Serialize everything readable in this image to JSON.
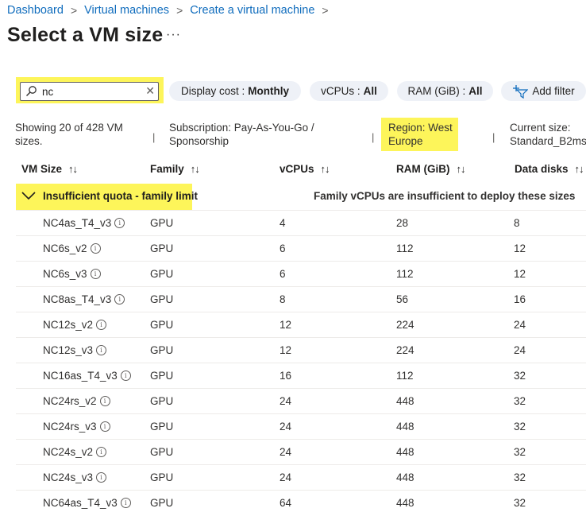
{
  "breadcrumb": [
    {
      "label": "Dashboard"
    },
    {
      "label": "Virtual machines"
    },
    {
      "label": "Create a virtual machine"
    }
  ],
  "page": {
    "title": "Select a VM size",
    "more": "···"
  },
  "search": {
    "value": "nc",
    "icon": "search-icon",
    "clear": "✕"
  },
  "filters": {
    "cost_label": "Display cost :",
    "cost_value": "Monthly",
    "vcpu_label": "vCPUs :",
    "vcpu_value": "All",
    "ram_label": "RAM (GiB) :",
    "ram_value": "All",
    "add_filter": "Add filter"
  },
  "info": {
    "count": "Showing 20 of 428 VM sizes.",
    "subscription": "Subscription: Pay-As-You-Go / Sponsorship",
    "region": "Region: West Europe",
    "current_size": "Current size: Standard_B2ms",
    "divider": "|"
  },
  "columns": [
    {
      "label": "VM Size",
      "sort": "↑↓"
    },
    {
      "label": "Family",
      "sort": "↑↓"
    },
    {
      "label": "vCPUs",
      "sort": "↑↓"
    },
    {
      "label": "RAM (GiB)",
      "sort": "↑↓"
    },
    {
      "label": "Data disks",
      "sort": "↑↓"
    }
  ],
  "group": {
    "label": "Insufficient quota - family limit",
    "message": "Family vCPUs are insufficient to deploy these sizes"
  },
  "rows": [
    {
      "name": "NC4as_T4_v3",
      "family": "GPU",
      "vcpus": "4",
      "ram": "28",
      "disks": "8"
    },
    {
      "name": "NC6s_v2",
      "family": "GPU",
      "vcpus": "6",
      "ram": "112",
      "disks": "12"
    },
    {
      "name": "NC6s_v3",
      "family": "GPU",
      "vcpus": "6",
      "ram": "112",
      "disks": "12"
    },
    {
      "name": "NC8as_T4_v3",
      "family": "GPU",
      "vcpus": "8",
      "ram": "56",
      "disks": "16"
    },
    {
      "name": "NC12s_v2",
      "family": "GPU",
      "vcpus": "12",
      "ram": "224",
      "disks": "24"
    },
    {
      "name": "NC12s_v3",
      "family": "GPU",
      "vcpus": "12",
      "ram": "224",
      "disks": "24"
    },
    {
      "name": "NC16as_T4_v3",
      "family": "GPU",
      "vcpus": "16",
      "ram": "112",
      "disks": "32"
    },
    {
      "name": "NC24rs_v2",
      "family": "GPU",
      "vcpus": "24",
      "ram": "448",
      "disks": "32"
    },
    {
      "name": "NC24rs_v3",
      "family": "GPU",
      "vcpus": "24",
      "ram": "448",
      "disks": "32"
    },
    {
      "name": "NC24s_v2",
      "family": "GPU",
      "vcpus": "24",
      "ram": "448",
      "disks": "32"
    },
    {
      "name": "NC24s_v3",
      "family": "GPU",
      "vcpus": "24",
      "ram": "448",
      "disks": "32"
    },
    {
      "name": "NC64as_T4_v3",
      "family": "GPU",
      "vcpus": "64",
      "ram": "448",
      "disks": "32"
    }
  ],
  "colors": {
    "highlight": "#fdf55a",
    "link": "#0f6cbd",
    "pill": "#eef1f7"
  }
}
